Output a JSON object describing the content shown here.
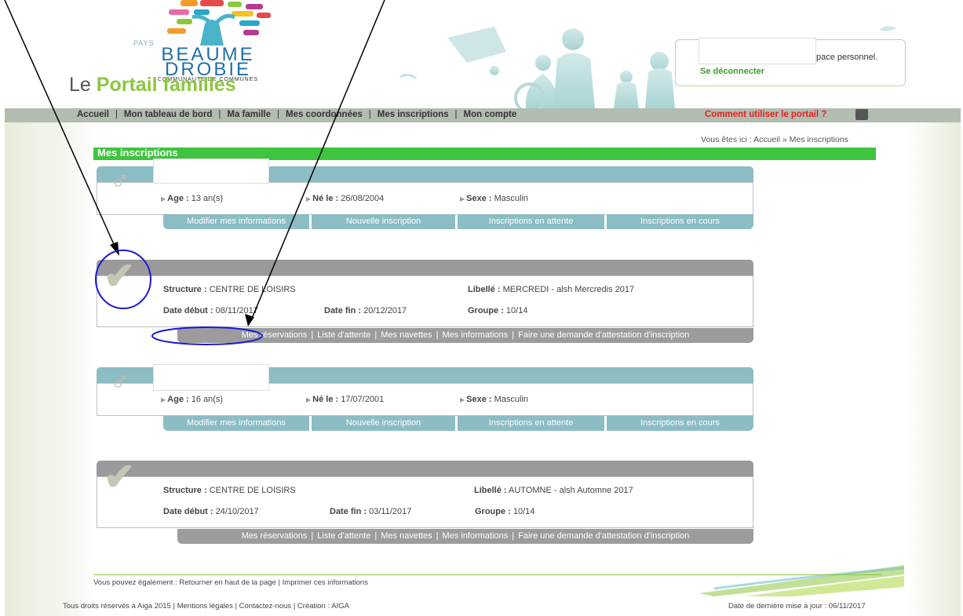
{
  "header": {
    "logo": {
      "pays": "PAYS",
      "name_line1": "BEAUME",
      "name_line2": "DROBIE",
      "subtitle": "COMMUNAUTE DE COMMUNES"
    },
    "portal_prefix": "Le ",
    "portal_name": "Portail familles",
    "space_text": "pace personnel.",
    "logout_label": "Se déconnecter"
  },
  "nav": {
    "items": [
      "Accueil",
      "Mon tableau de bord",
      "Ma famille",
      "Mes coordonnées",
      "Mes inscriptions",
      "Mon compte"
    ],
    "help_label": "Comment utiliser le portail ?"
  },
  "breadcrumb": "Vous êtes ici : Accueil » Mes inscriptions",
  "page_title": "Mes inscriptions",
  "children": [
    {
      "age_label": "Age :",
      "age_value": "13 an(s)",
      "born_label": "Né le :",
      "born_value": "26/08/2004",
      "sex_label": "Sexe :",
      "sex_value": "Masculin",
      "tabs": [
        "Modifier mes informations",
        "Nouvelle inscription",
        "Inscriptions en attente",
        "Inscriptions en cours"
      ],
      "inscription": {
        "structure_label": "Structure :",
        "structure_value": "CENTRE DE LOISIRS",
        "libelle_label": "Libellé :",
        "libelle_value": "MERCREDI - alsh Mercredis 2017",
        "start_label": "Date début :",
        "start_value": "08/11/2017",
        "end_label": "Date fin :",
        "end_value": "20/12/2017",
        "group_label": "Groupe :",
        "group_value": "10/14",
        "actions": [
          "Mes réservations",
          "Liste d'attente",
          "Mes navettes",
          "Mes informations",
          "Faire une demande d'attestation d'inscription"
        ]
      }
    },
    {
      "age_label": "Age :",
      "age_value": "16 an(s)",
      "born_label": "Né le :",
      "born_value": "17/07/2001",
      "sex_label": "Sexe :",
      "sex_value": "Masculin",
      "tabs": [
        "Modifier mes informations",
        "Nouvelle inscription",
        "Inscriptions en attente",
        "Inscriptions en cours"
      ],
      "inscription": {
        "structure_label": "Structure :",
        "structure_value": "CENTRE DE LOISIRS",
        "libelle_label": "Libellé :",
        "libelle_value": "AUTOMNE - alsh Automne 2017",
        "start_label": "Date début :",
        "start_value": "24/10/2017",
        "end_label": "Date fin :",
        "end_value": "03/11/2017",
        "group_label": "Groupe :",
        "group_value": "10/14",
        "actions": [
          "Mes réservations",
          "Liste d'attente",
          "Mes navettes",
          "Mes informations",
          "Faire une demande d'attestation d'inscription"
        ]
      }
    }
  ],
  "footer": {
    "also_prefix": "Vous pouvez également : ",
    "back_top": "Retourner en haut de la page",
    "print": "Imprimer ces informations",
    "rights": "Tous droits réservés à Aiga 2015",
    "legal": "Mentions légales",
    "contact": "Contactez-nous",
    "creation": "Création : AIGA",
    "last_update": "Date de dernière mise à jour : 06/11/2017"
  },
  "colors": {
    "green": "#3ec43e",
    "teal_tab": "#8cbcc4",
    "grey_tab": "#9c9c9c",
    "nav": "#b3bcb1",
    "help_red": "#e5211d",
    "annotation_blue": "#1a1ad8"
  }
}
